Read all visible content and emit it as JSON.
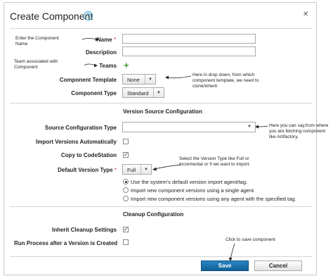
{
  "dialog": {
    "title": "Create Component",
    "help_glyph": "?",
    "close_glyph": "✕"
  },
  "fields": {
    "name": {
      "label": "Name",
      "required_mark": "*",
      "value": ""
    },
    "description": {
      "label": "Description",
      "value": ""
    },
    "teams": {
      "label": "Teams",
      "add_glyph": "+"
    },
    "component_template": {
      "label": "Component Template",
      "selected": "None"
    },
    "component_type": {
      "label": "Component Type",
      "selected": "Standard"
    },
    "source_configuration_type": {
      "label": "Source Configuration Type",
      "selected": ""
    },
    "import_versions_automatically": {
      "label": "Import Versions Automatically",
      "checked": false
    },
    "copy_to_codestation": {
      "label": "Copy to CodeStation",
      "checked": true
    },
    "default_version_type": {
      "label": "Default Version Type",
      "required_mark": "*",
      "selected": "Full"
    },
    "import_agent_options": [
      {
        "label": "Use the system's default version import agent/tag.",
        "selected": true
      },
      {
        "label": "Import new component versions using a single agent.",
        "selected": false
      },
      {
        "label": "Import new component versions using any agent with the specified tag.",
        "selected": false
      }
    ],
    "inherit_cleanup_settings": {
      "label": "Inherit Cleanup Settings",
      "checked": true
    },
    "run_process_after_version": {
      "label": "Run Process after a Version is Created",
      "checked": false
    }
  },
  "sections": {
    "version_source": "Version Source Configuration",
    "cleanup": "Cleanup Configuration"
  },
  "buttons": {
    "save": "Save",
    "cancel": "Cancel"
  },
  "annotations": {
    "name_note": "Enter the Component Name",
    "teams_note": "Team associated with Component",
    "template_note": "Here in drop down, from which component template, we need to clone/inherit",
    "source_note": "Here you can say,from where you are fetching component like Artifactory,",
    "version_type_note": "Select the Version Type like Full or Incremental or if we want to import.",
    "save_note": "Click to save component"
  },
  "colors": {
    "accent_blue": "#1a6fae",
    "help_blue": "#2e93c9",
    "add_green": "#3d9a2b",
    "required_red": "#c0392b"
  },
  "icons": {
    "help": "question-circle-icon",
    "close": "close-icon",
    "add": "plus-icon",
    "dropdown": "chevron-down-icon"
  }
}
